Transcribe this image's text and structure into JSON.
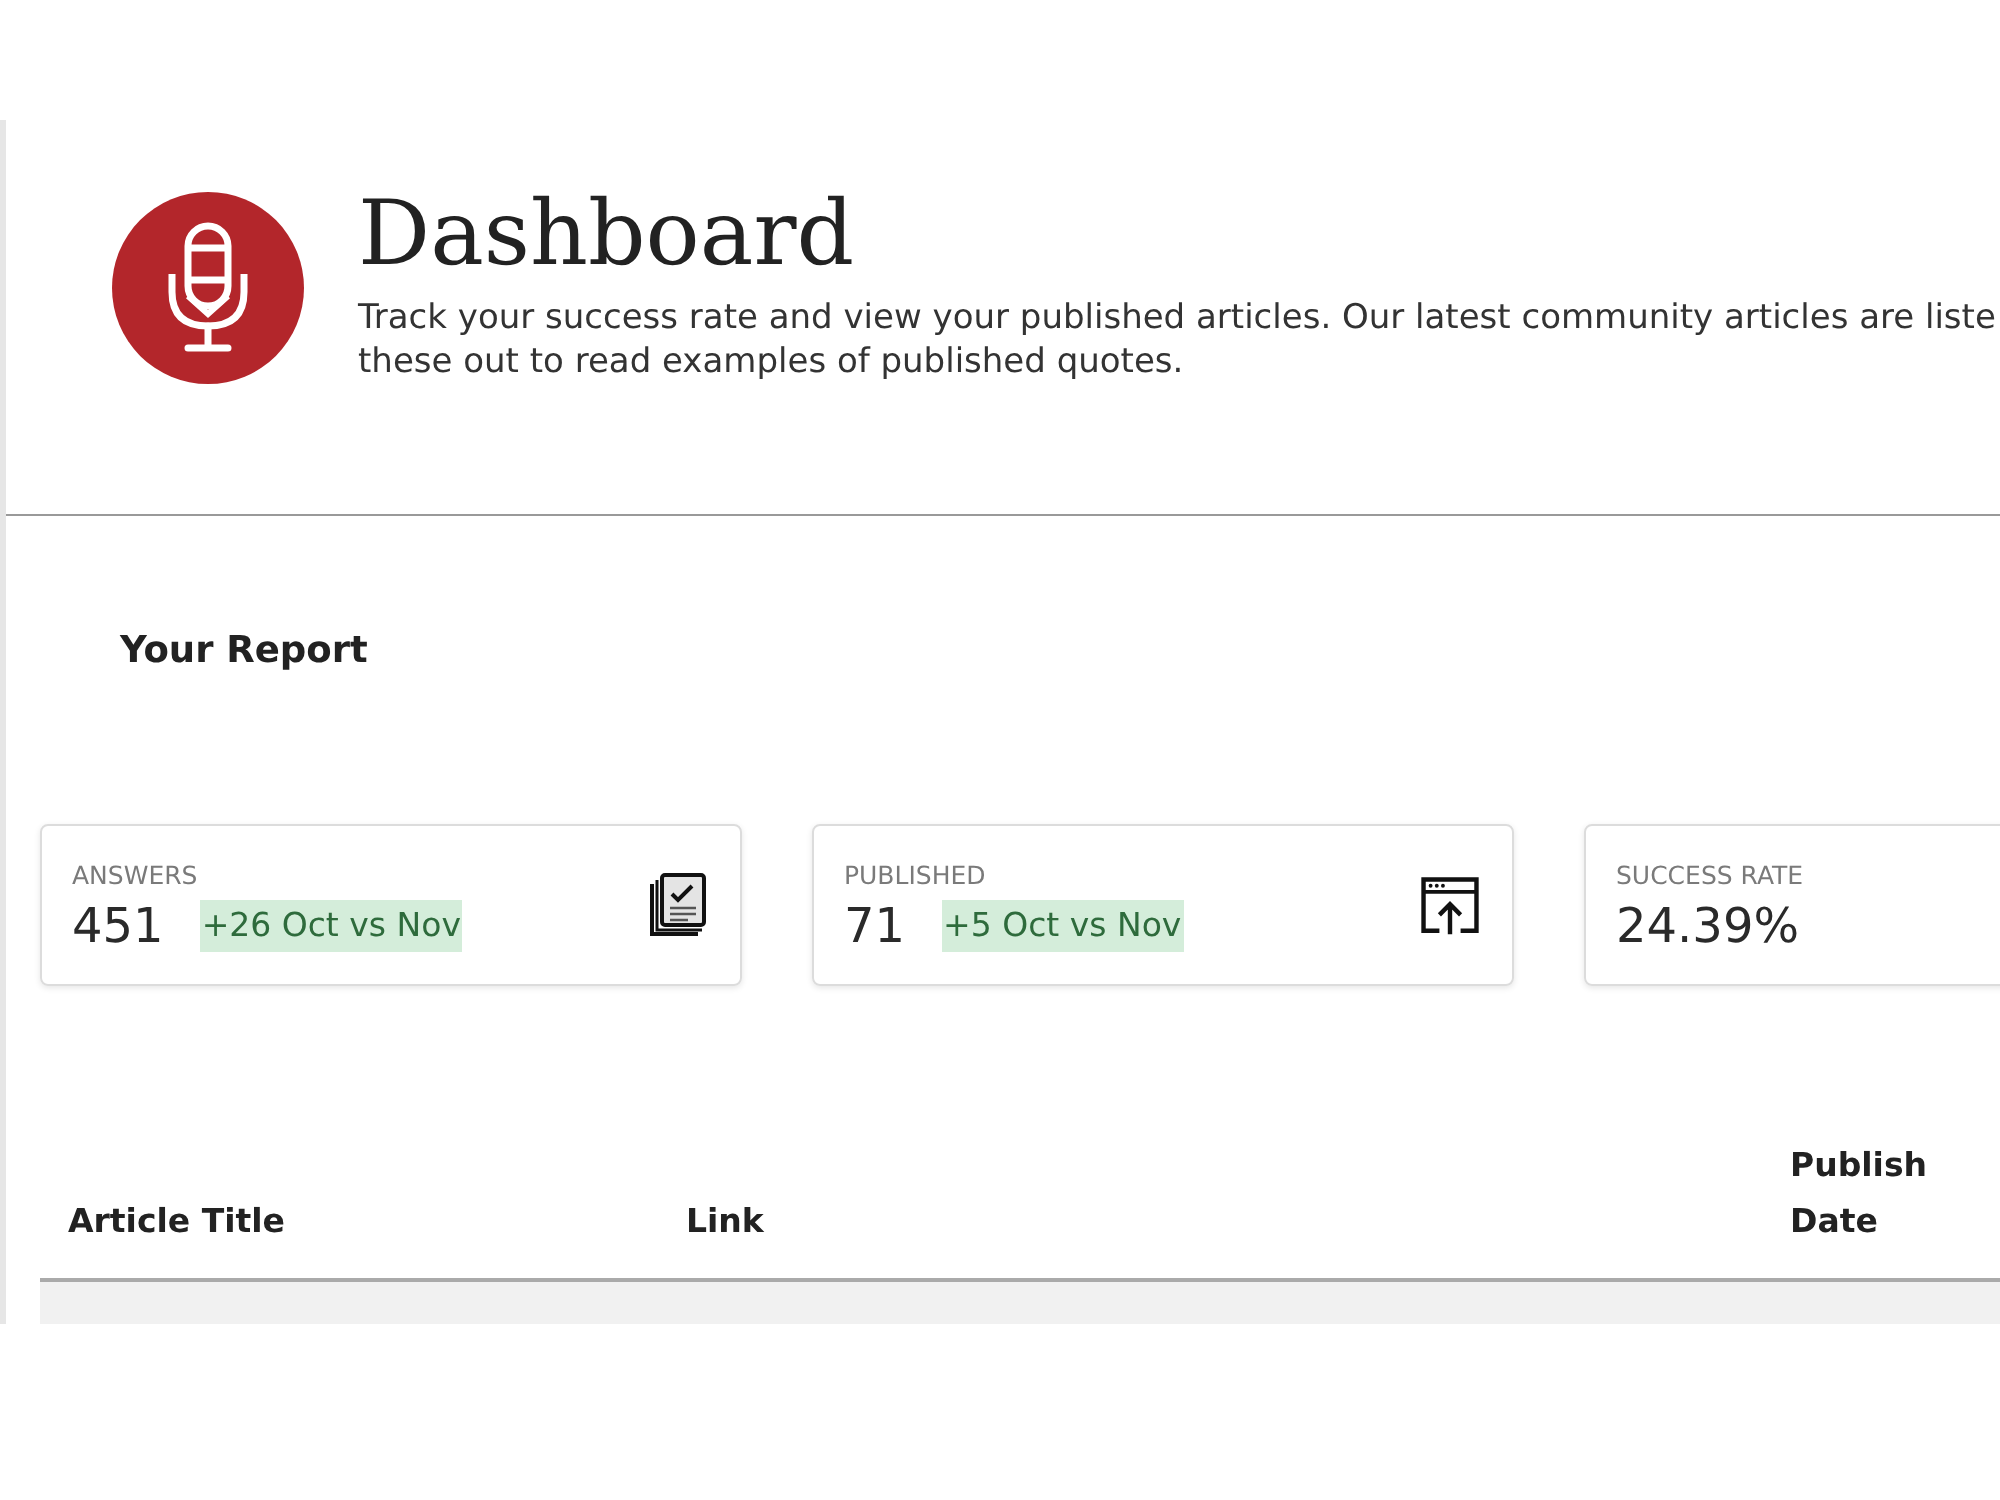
{
  "header": {
    "title": "Dashboard",
    "description": [
      "Track your success rate and view your published articles. Our latest community articles are liste",
      "these out to read examples of published quotes."
    ]
  },
  "report": {
    "title": "Your Report",
    "cards": [
      {
        "kind": "answers",
        "label": "ANSWERS",
        "value": "451",
        "delta": "+26 Oct vs Nov"
      },
      {
        "kind": "published",
        "label": "PUBLISHED",
        "value": "71",
        "delta": "+5 Oct vs Nov"
      },
      {
        "kind": "rate",
        "label": "SUCCESS RATE",
        "value": "24.39%"
      }
    ]
  },
  "table": {
    "columns": [
      "Article Title",
      "Link",
      "Publish Date"
    ]
  }
}
